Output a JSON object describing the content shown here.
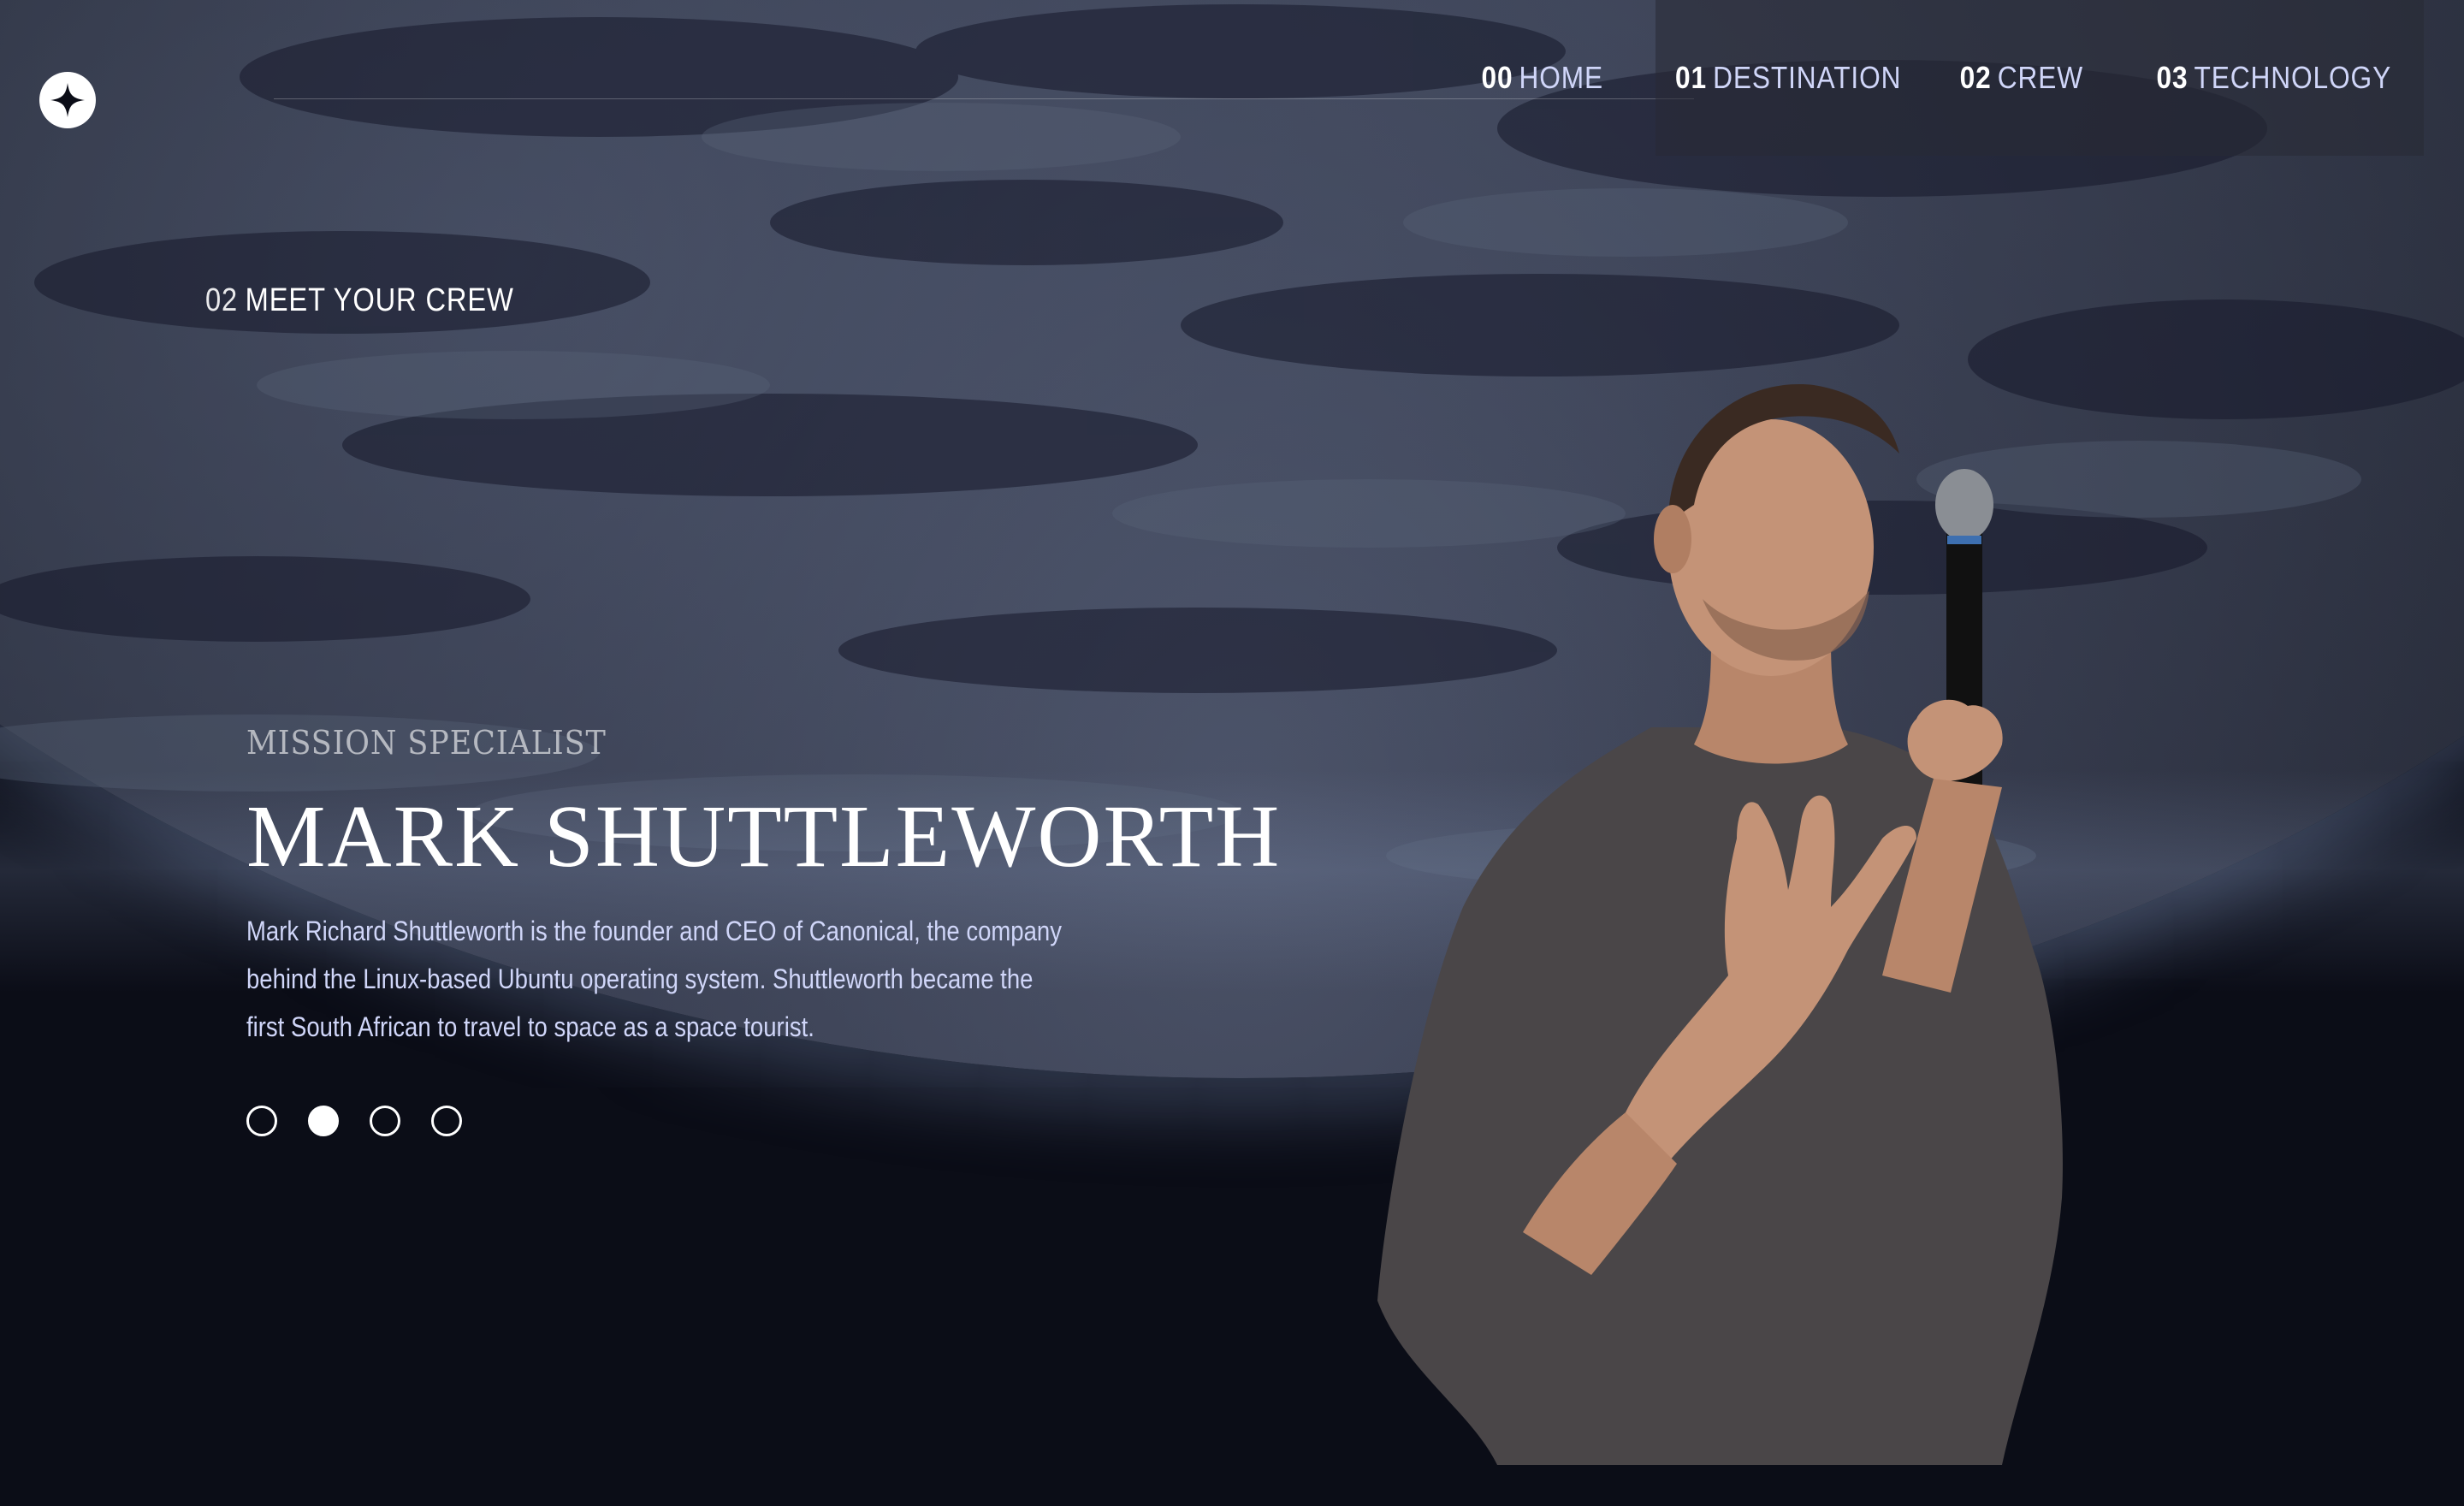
{
  "nav": {
    "items": [
      {
        "num": "00",
        "label": "HOME"
      },
      {
        "num": "01",
        "label": "DESTINATION"
      },
      {
        "num": "02",
        "label": "CREW"
      },
      {
        "num": "03",
        "label": "TECHNOLOGY"
      }
    ]
  },
  "section": {
    "num": "02",
    "title": "MEET YOUR CREW"
  },
  "crew": {
    "role": "MISSION SPECIALIST",
    "name": "MARK SHUTTLEWORTH",
    "bio": "Mark Richard Shuttleworth is the founder and CEO of Canonical, the company behind the Linux-based Ubuntu operating system. Shuttleworth became the first South African to travel to space as a space tourist."
  },
  "pagination": {
    "count": 4,
    "active_index": 1
  },
  "icons": {
    "logo": "four-point-star-icon"
  },
  "colors": {
    "background": "#0b0d17",
    "text": "#ffffff",
    "muted_text": "#d0d6f9"
  }
}
